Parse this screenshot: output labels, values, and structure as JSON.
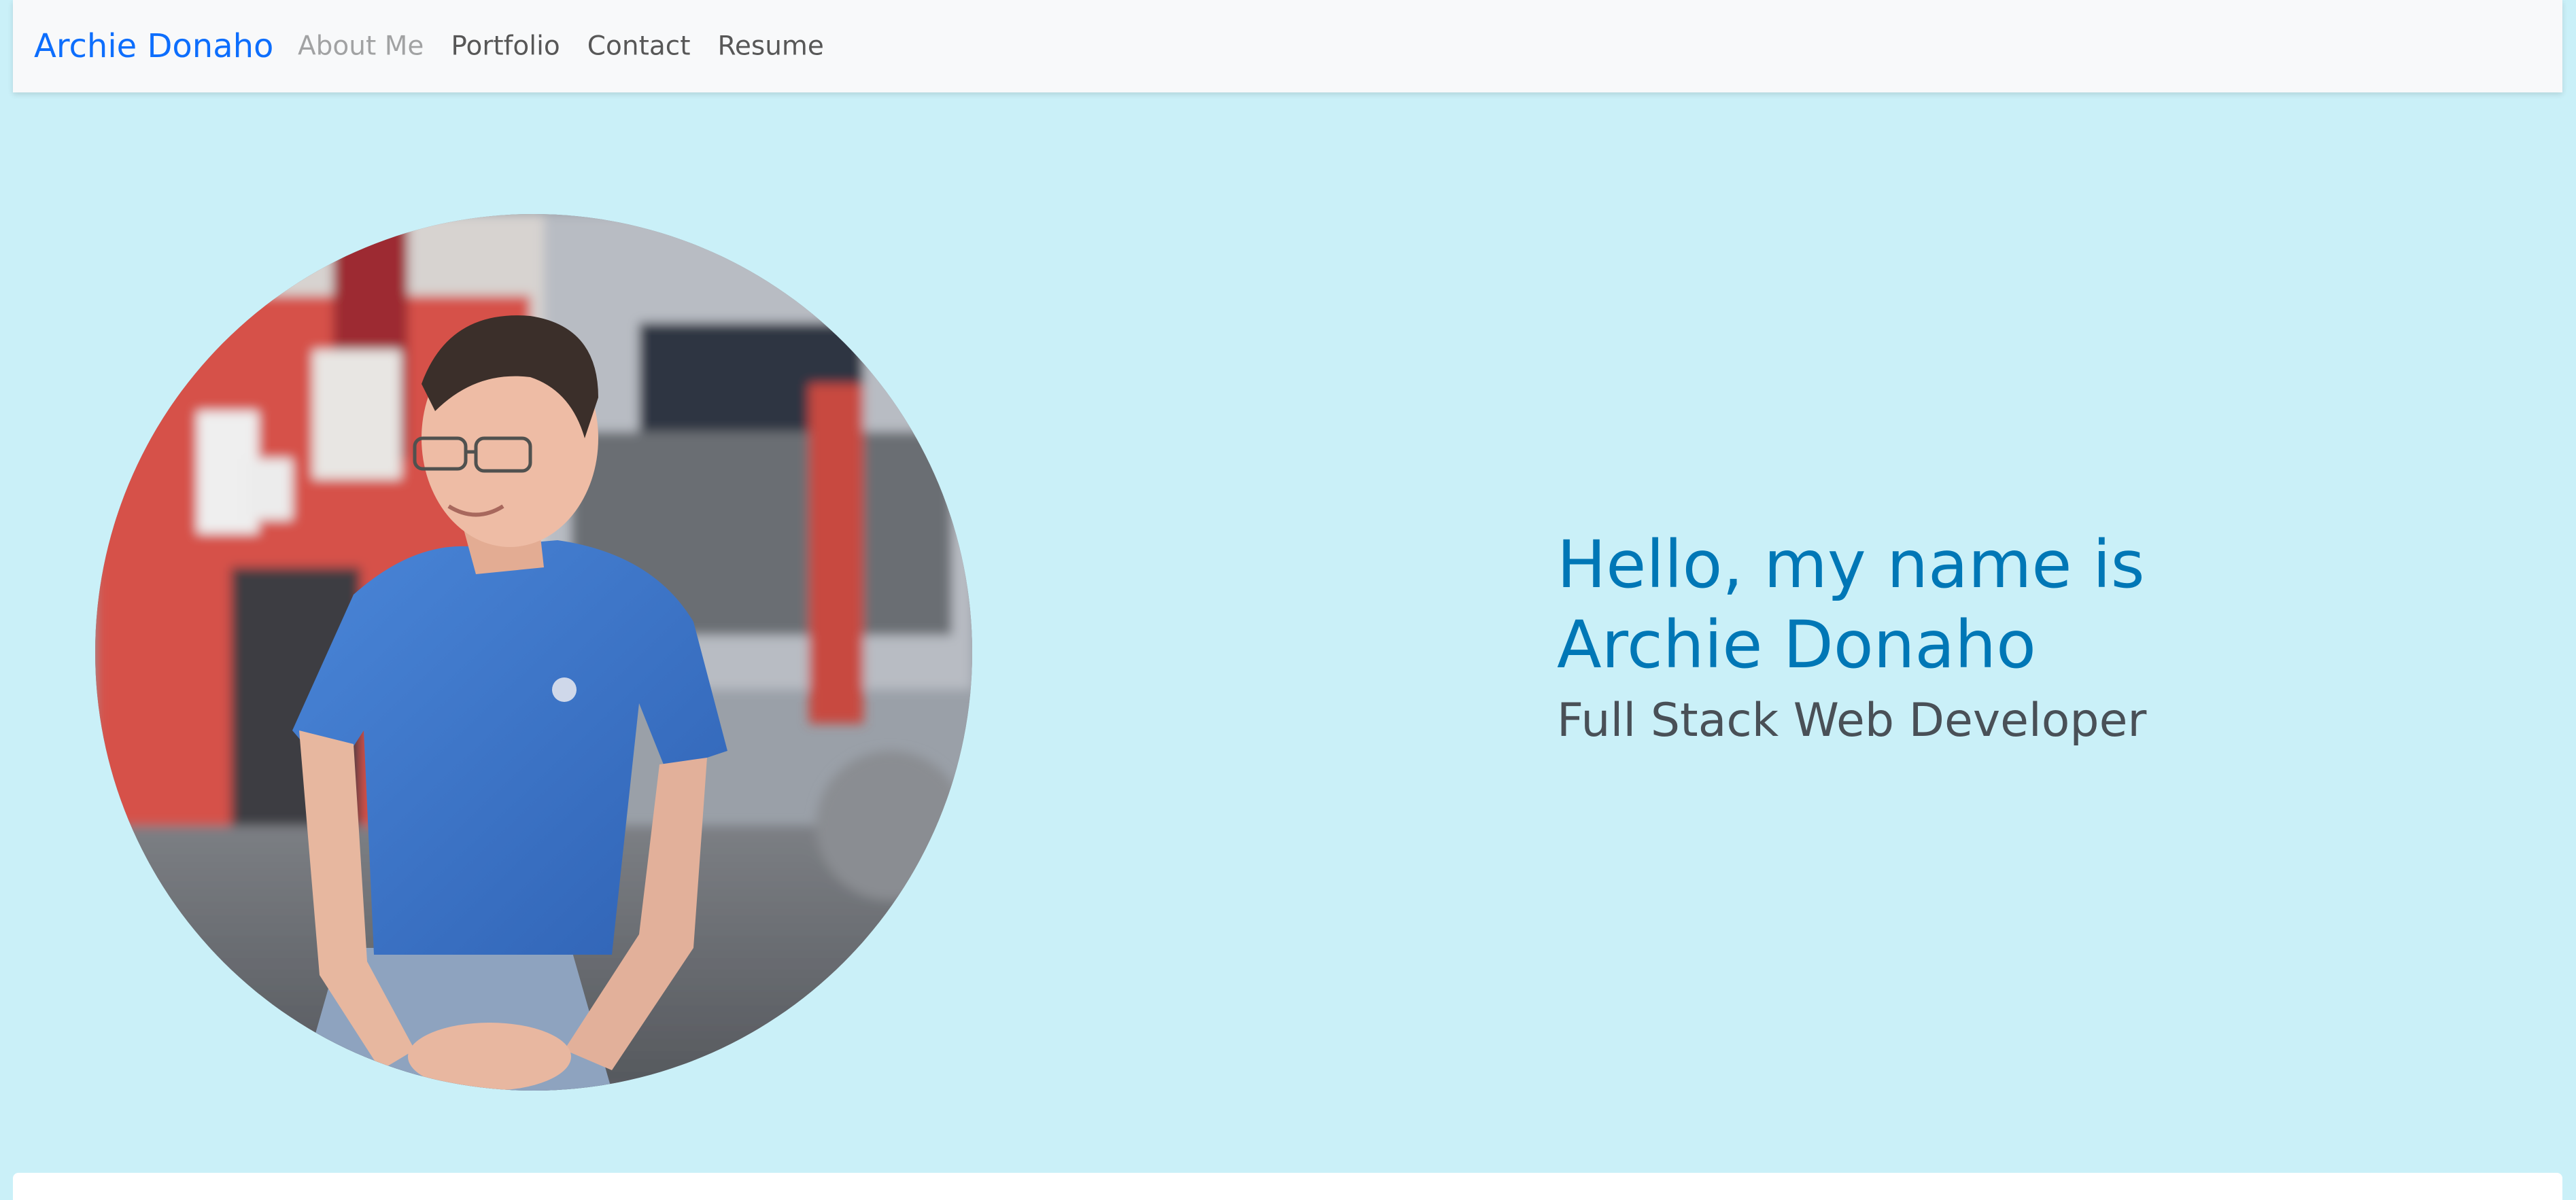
{
  "navbar": {
    "brand": "Archie Donaho",
    "links": [
      {
        "label": "About Me",
        "active": true
      },
      {
        "label": "Portfolio",
        "active": false
      },
      {
        "label": "Contact",
        "active": false
      },
      {
        "label": "Resume",
        "active": false
      }
    ]
  },
  "hero": {
    "greeting_line1": "Hello, my name is",
    "greeting_line2": "Archie Donaho",
    "subtitle": "Full Stack Web Developer",
    "photo_alt": "Profile photo"
  },
  "colors": {
    "page_background": "#caf0f8",
    "brand": "#0d6efd",
    "heading": "#0077b6",
    "subtitle": "#495057",
    "navbar_background": "#f8f9fa"
  }
}
